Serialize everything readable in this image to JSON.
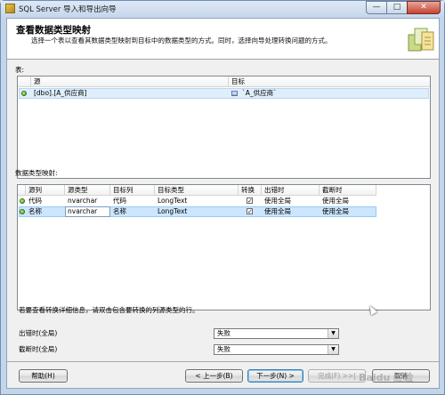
{
  "window": {
    "title": "SQL Server 导入和导出向导"
  },
  "header": {
    "title": "查看数据类型映射",
    "subtitle": "选择一个表以查看其数据类型映射到目标中的数据类型的方式。同时，选择向导处理转换问题的方式。"
  },
  "tables_section": {
    "label": "表:",
    "columns": [
      "源",
      "目标"
    ],
    "rows": [
      {
        "source": "[dbo].[A_供应商]",
        "target": "`A_供应商`"
      }
    ]
  },
  "mapping_section": {
    "label": "数据类型映射:",
    "columns": [
      "源列",
      "源类型",
      "目标列",
      "目标类型",
      "转换",
      "出错时",
      "截断时"
    ],
    "rows": [
      {
        "src_col": "代码",
        "src_type": "nvarchar",
        "dst_col": "代码",
        "dst_type": "LongText",
        "convert": "✓",
        "on_error": "使用全局",
        "on_trunc": "使用全局",
        "selected": false
      },
      {
        "src_col": "名称",
        "src_type": "nvarchar",
        "dst_col": "名称",
        "dst_type": "LongText",
        "convert": "✓",
        "on_error": "使用全局",
        "on_trunc": "使用全局",
        "selected": true
      }
    ]
  },
  "hint": "若要查看转换详细信息，请双击包含要转换的列源类型的行。",
  "global": {
    "on_error_label": "出错时(全局)",
    "on_error_value": "失败",
    "on_trunc_label": "截断时(全局)",
    "on_trunc_value": "失败"
  },
  "buttons": {
    "help": "帮助(H)",
    "back": "< 上一步(B)",
    "next": "下一步(N) >",
    "finish": "完成(F) >>|",
    "cancel": "取消"
  },
  "watermark": "Baidu 经验",
  "icons": {
    "minimize": "—",
    "maximize": "□",
    "close": "✕",
    "dropdown": "▼"
  }
}
